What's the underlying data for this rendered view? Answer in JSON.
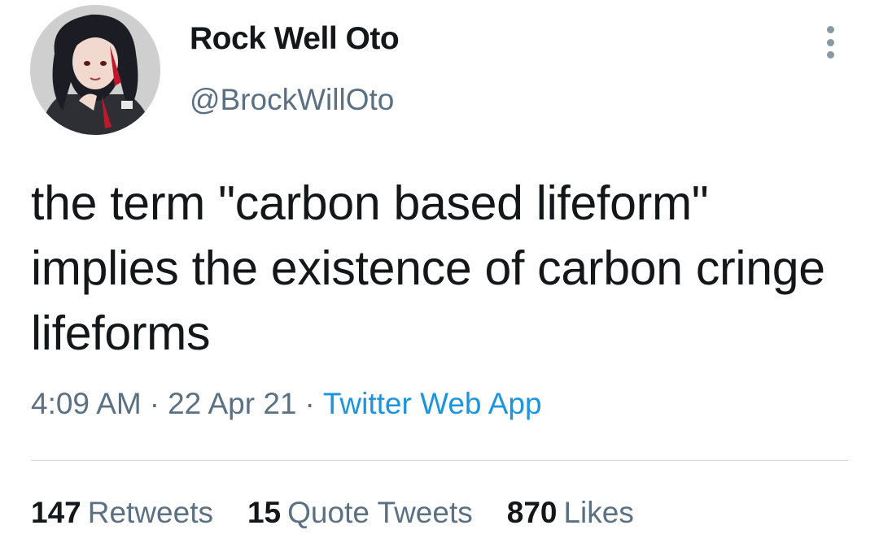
{
  "tweet": {
    "author": {
      "display_name": "Rock Well Oto",
      "handle": "@BrockWillOto",
      "avatar_icon": "anime-character-avatar"
    },
    "text": "the term \"carbon based lifeform\" implies the existence of carbon cringe lifeforms",
    "time": "4:09 AM",
    "date": "22 Apr 21",
    "separator": "·",
    "source": "Twitter Web App",
    "stats": {
      "retweets_count": "147",
      "retweets_label": "Retweets",
      "quote_tweets_count": "15",
      "quote_tweets_label": "Quote Tweets",
      "likes_count": "870",
      "likes_label": "Likes"
    }
  },
  "colors": {
    "text": "#14171a",
    "secondary": "#5b7083",
    "link": "#1b95e0",
    "divider": "#cfd9de"
  }
}
